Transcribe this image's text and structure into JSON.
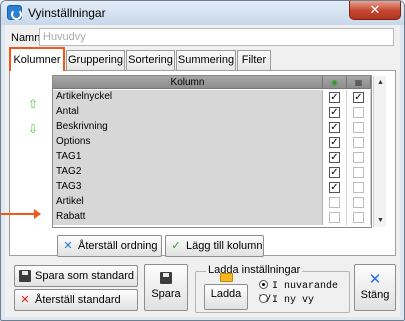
{
  "window": {
    "title": "Vyinställningar",
    "close_glyph": "✕"
  },
  "name_field": {
    "label": "Namn",
    "placeholder": "Huvudvy"
  },
  "tabs": [
    {
      "label": "Kolumner",
      "active": true
    },
    {
      "label": "Gruppering",
      "active": false
    },
    {
      "label": "Sortering",
      "active": false
    },
    {
      "label": "Summering",
      "active": false
    },
    {
      "label": "Filter",
      "active": false
    }
  ],
  "grid": {
    "column_header": "Kolumn",
    "visible_icon": "eye-icon",
    "grid_icon": "grid-icon",
    "rows": [
      {
        "label": "Artikelnyckel",
        "col1": true,
        "col2": true
      },
      {
        "label": "Antal",
        "col1": true,
        "col2": false
      },
      {
        "label": "Beskrivning",
        "col1": true,
        "col2": false
      },
      {
        "label": "Options",
        "col1": true,
        "col2": false
      },
      {
        "label": "TAG1",
        "col1": true,
        "col2": false
      },
      {
        "label": "TAG2",
        "col1": true,
        "col2": false
      },
      {
        "label": "TAG3",
        "col1": true,
        "col2": false
      },
      {
        "label": "Artikel",
        "col1": false,
        "col2": false
      },
      {
        "label": "Rabatt",
        "col1": false,
        "col2": false
      }
    ]
  },
  "buttons": {
    "reset_order": "Återställ ordning",
    "add_column": "Lägg till kolumn",
    "save_standard": "Spara som standard",
    "reset_standard": "Återställ standard",
    "save": "Spara",
    "load": "Ladda",
    "close": "Stäng"
  },
  "load_group": {
    "title": "Ladda inställningar",
    "option_current": "I nuvarande vy",
    "option_new": "I ny vy",
    "selected": "option_current"
  },
  "colors": {
    "accent_orange": "#f0591b",
    "close_red": "#c3452e",
    "icon_blue": "#2a6fd6",
    "icon_red": "#d9201c",
    "icon_green": "#2f9a2a"
  }
}
